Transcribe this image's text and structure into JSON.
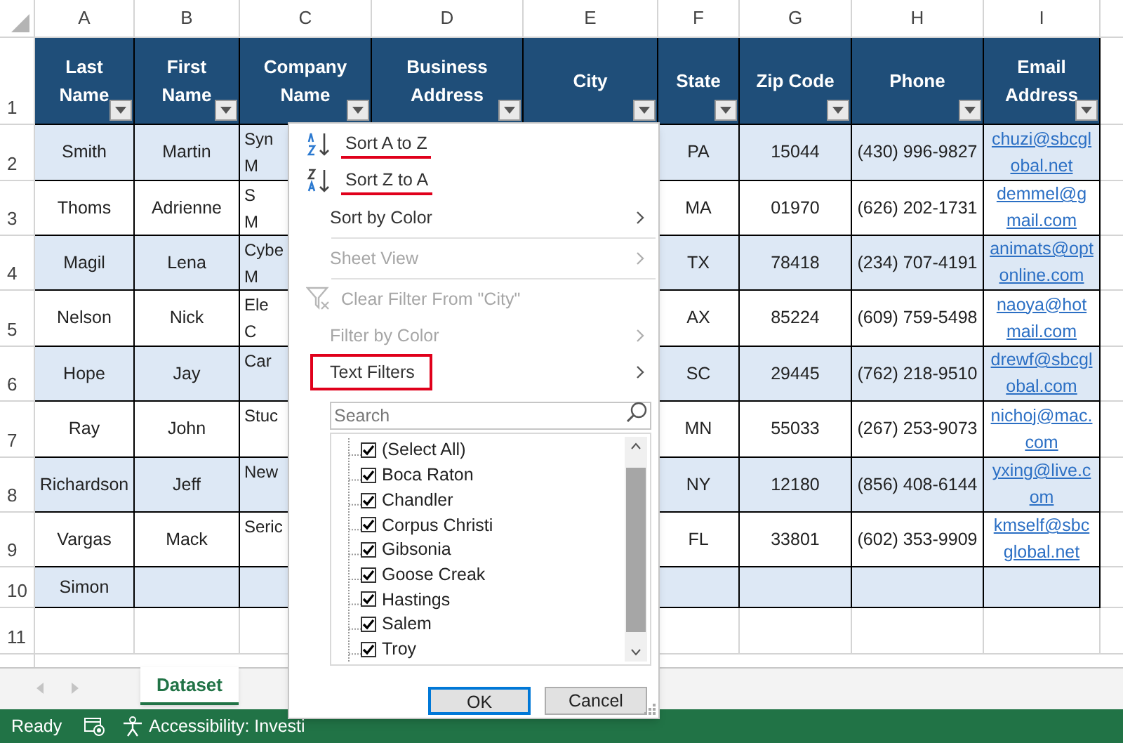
{
  "column_letters": [
    "A",
    "B",
    "C",
    "D",
    "E",
    "F",
    "G",
    "H",
    "I"
  ],
  "row_numbers": [
    "1",
    "2",
    "3",
    "4",
    "5",
    "6",
    "7",
    "8",
    "9",
    "10",
    "11"
  ],
  "table": {
    "columns": [
      {
        "label": "Last Name"
      },
      {
        "label": "First Name"
      },
      {
        "label": "Company Name"
      },
      {
        "label": "Business Address"
      },
      {
        "label": "City"
      },
      {
        "label": "State"
      },
      {
        "label": "Zip Code"
      },
      {
        "label": "Phone"
      },
      {
        "label": "Email Address"
      }
    ],
    "rows": [
      {
        "last_name": "Smith",
        "first_name": "Martin",
        "company_name": "Syn\nM",
        "state": "PA",
        "zip_code": "15044",
        "phone": "(430) 996-9827",
        "email": "chuzi@sbcglobal.net"
      },
      {
        "last_name": "Thoms",
        "first_name": "Adrienne",
        "company_name": "S\nM",
        "state": "MA",
        "zip_code": "01970",
        "phone": "(626) 202-1731",
        "email": "demmel@gmail.com"
      },
      {
        "last_name": "Magil",
        "first_name": "Lena",
        "company_name": "Cybe\nM",
        "state": "TX",
        "zip_code": "78418",
        "phone": "(234) 707-4191",
        "email": "animats@optonline.com"
      },
      {
        "last_name": "Nelson",
        "first_name": "Nick",
        "company_name": "Ele\nC",
        "state": "AX",
        "zip_code": "85224",
        "phone": "(609) 759-5498",
        "email": "naoya@hotmail.com"
      },
      {
        "last_name": "Hope",
        "first_name": "Jay",
        "company_name": "Car",
        "state": "SC",
        "zip_code": "29445",
        "phone": "(762) 218-9510",
        "email": "drewf@sbcglobal.com"
      },
      {
        "last_name": "Ray",
        "first_name": "John",
        "company_name": "Stuc",
        "state": "MN",
        "zip_code": "55033",
        "phone": "(267) 253-9073",
        "email": "nichoj@mac.com"
      },
      {
        "last_name": "Richardson",
        "first_name": "Jeff",
        "company_name": "New",
        "state": "NY",
        "zip_code": "12180",
        "phone": "(856) 408-6144",
        "email": "yxing@live.com"
      },
      {
        "last_name": "Vargas",
        "first_name": "Mack",
        "company_name": "Seric",
        "state": "FL",
        "zip_code": "33801",
        "phone": "(602) 353-9909",
        "email": "kmself@sbcglobal.net"
      },
      {
        "last_name": "Simon"
      }
    ]
  },
  "filter_menu": {
    "items": [
      {
        "kind": "sort_ascending",
        "label": "Sort A to Z",
        "disabled": false,
        "submenu": false,
        "underlined": true,
        "boxed": false
      },
      {
        "kind": "sort_descending",
        "label": "Sort Z to A",
        "disabled": false,
        "submenu": false,
        "underlined": true,
        "boxed": false
      },
      {
        "kind": "command",
        "label": "Sort by Color",
        "disabled": false,
        "submenu": true,
        "underlined": false,
        "boxed": false
      },
      {
        "kind": "separator"
      },
      {
        "kind": "command",
        "label": "Sheet View",
        "disabled": true,
        "submenu": true,
        "underlined": false,
        "boxed": false
      },
      {
        "kind": "separator"
      },
      {
        "kind": "clear_filter",
        "label": "Clear Filter From \"City\"",
        "disabled": true,
        "submenu": false,
        "underlined": false,
        "boxed": false
      },
      {
        "kind": "command",
        "label": "Filter by Color",
        "disabled": true,
        "submenu": true,
        "underlined": false,
        "boxed": false
      },
      {
        "kind": "command",
        "label": "Text Filters",
        "disabled": false,
        "submenu": true,
        "underlined": false,
        "boxed": true
      }
    ],
    "search": {
      "placeholder": "Search"
    },
    "list": [
      {
        "label": "(Select All)",
        "checked": true
      },
      {
        "label": "Boca Raton",
        "checked": true
      },
      {
        "label": "Chandler",
        "checked": true
      },
      {
        "label": "Corpus Christi",
        "checked": true
      },
      {
        "label": "Gibsonia",
        "checked": true
      },
      {
        "label": "Goose Creak",
        "checked": true
      },
      {
        "label": "Hastings",
        "checked": true
      },
      {
        "label": "Salem",
        "checked": true
      },
      {
        "label": "Troy",
        "checked": true
      }
    ],
    "buttons": [
      {
        "label": "OK",
        "default": true
      },
      {
        "label": "Cancel",
        "default": false
      }
    ]
  },
  "sheet_tabs": [
    {
      "label": "Dataset",
      "selected": true
    }
  ],
  "status_bar": {
    "state": "Ready",
    "accessibility": "Accessibility: Investi"
  }
}
